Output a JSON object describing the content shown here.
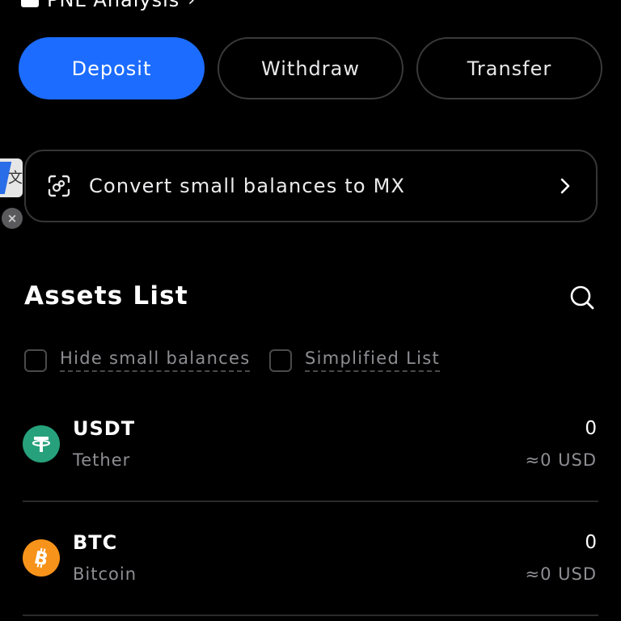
{
  "header": {
    "title": "PNL Analysis",
    "chevron": "›"
  },
  "actions": {
    "deposit_label": "Deposit",
    "withdraw_label": "Withdraw",
    "transfer_label": "Transfer",
    "accent_color": "#1c6cff"
  },
  "side_widget": {
    "icon": "translate-icon",
    "glyph": "文",
    "close": "×"
  },
  "convert": {
    "label": "Convert small balances to MX",
    "icon": "convert-scan-icon"
  },
  "assets": {
    "title": "Assets List",
    "filters": {
      "hide_small": "Hide small balances",
      "simplified": "Simplified List"
    },
    "items": [
      {
        "symbol": "USDT",
        "name": "Tether",
        "amount": "0",
        "usd_value": "≈0 USD",
        "icon": "tether-icon",
        "color": "#26a17b"
      },
      {
        "symbol": "BTC",
        "name": "Bitcoin",
        "amount": "0",
        "usd_value": "≈0 USD",
        "icon": "bitcoin-icon",
        "color": "#f7931a"
      }
    ]
  }
}
